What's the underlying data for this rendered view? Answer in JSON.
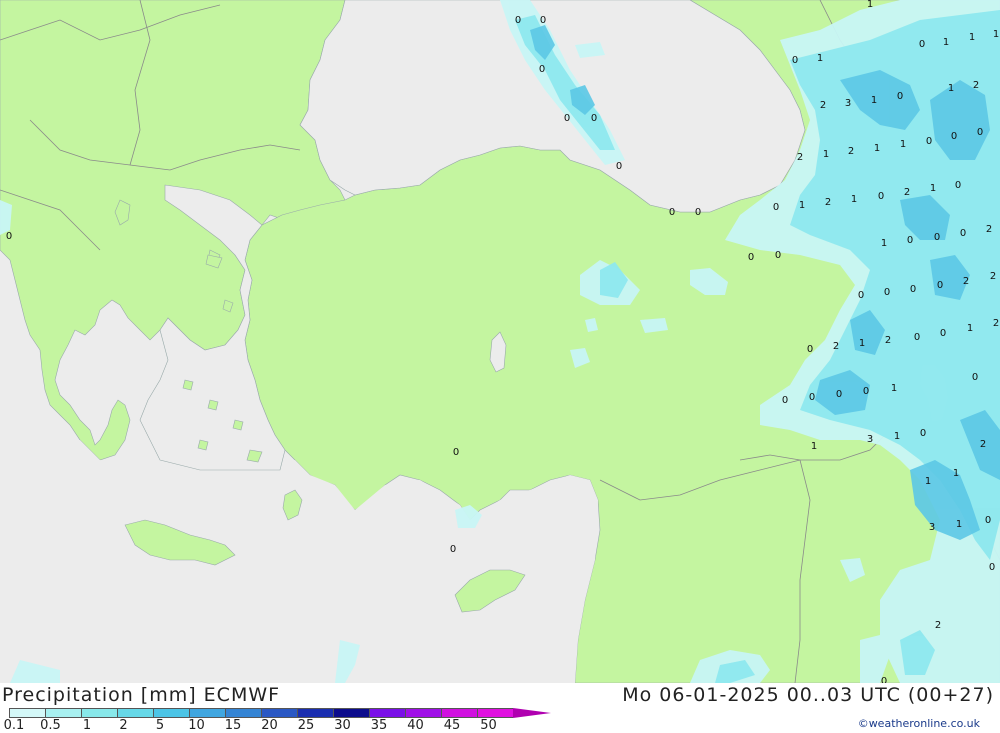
{
  "header": {
    "title": "Precipitation [mm] ECMWF",
    "valid_time": "Mo 06-01-2025 00..03 UTC (00+27)",
    "credit": "©weatheronline.co.uk"
  },
  "legend": {
    "ticks": [
      "0.1",
      "0.5",
      "1",
      "2",
      "5",
      "10",
      "15",
      "20",
      "25",
      "30",
      "35",
      "40",
      "45",
      "50"
    ],
    "colors": [
      "#d4f8f8",
      "#a8f0f0",
      "#88e8ea",
      "#66d8e8",
      "#4cc4e6",
      "#40a6e0",
      "#3484d4",
      "#2a58c4",
      "#1a2eb0",
      "#0c0c8c",
      "#7a10e8",
      "#a010e8",
      "#d010e0",
      "#e010e0",
      "#b000b0"
    ]
  },
  "colors": {
    "sea": "#ececec",
    "land": "#c4f5a0",
    "border": "#8a8a8a",
    "precip_light": "#c8f6f6",
    "precip_medium": "#8ee8ee",
    "precip_heavy": "#5cc8e6"
  },
  "map_values": [
    {
      "t": "0"
    },
    {
      "t": "0"
    },
    {
      "t": "0"
    },
    {
      "t": "0"
    },
    {
      "t": "0"
    },
    {
      "t": "0"
    },
    {
      "t": "0"
    },
    {
      "t": "0"
    },
    {
      "t": "0"
    },
    {
      "t": "0"
    },
    {
      "t": "0"
    },
    {
      "t": "0"
    },
    {
      "t": "0"
    },
    {
      "t": "1"
    },
    {
      "t": "0"
    },
    {
      "t": "1"
    },
    {
      "t": "0"
    },
    {
      "t": "1"
    },
    {
      "t": "1"
    },
    {
      "t": "1"
    },
    {
      "t": "2"
    },
    {
      "t": "3"
    },
    {
      "t": "1"
    },
    {
      "t": "0"
    },
    {
      "t": "1"
    },
    {
      "t": "2"
    },
    {
      "t": "2"
    },
    {
      "t": "1"
    },
    {
      "t": "2"
    },
    {
      "t": "1"
    },
    {
      "t": "1"
    },
    {
      "t": "0"
    },
    {
      "t": "0"
    },
    {
      "t": "0"
    },
    {
      "t": "0"
    },
    {
      "t": "1"
    },
    {
      "t": "2"
    },
    {
      "t": "1"
    },
    {
      "t": "0"
    },
    {
      "t": "2"
    },
    {
      "t": "1"
    },
    {
      "t": "0"
    },
    {
      "t": "1"
    },
    {
      "t": "0"
    },
    {
      "t": "0"
    },
    {
      "t": "0"
    },
    {
      "t": "2"
    },
    {
      "t": "0"
    },
    {
      "t": "0"
    },
    {
      "t": "0"
    },
    {
      "t": "0"
    },
    {
      "t": "2"
    },
    {
      "t": "2"
    },
    {
      "t": "0"
    },
    {
      "t": "2"
    },
    {
      "t": "1"
    },
    {
      "t": "2"
    },
    {
      "t": "0"
    },
    {
      "t": "0"
    },
    {
      "t": "1"
    },
    {
      "t": "2"
    },
    {
      "t": "0"
    },
    {
      "t": "0"
    },
    {
      "t": "0"
    },
    {
      "t": "0"
    },
    {
      "t": "0"
    },
    {
      "t": "1"
    },
    {
      "t": "0"
    },
    {
      "t": "1"
    },
    {
      "t": "3"
    },
    {
      "t": "1"
    },
    {
      "t": "1"
    },
    {
      "t": "1"
    },
    {
      "t": "2"
    },
    {
      "t": "3"
    },
    {
      "t": "1"
    },
    {
      "t": "0"
    },
    {
      "t": "0"
    },
    {
      "t": "2"
    },
    {
      "t": "0"
    }
  ]
}
